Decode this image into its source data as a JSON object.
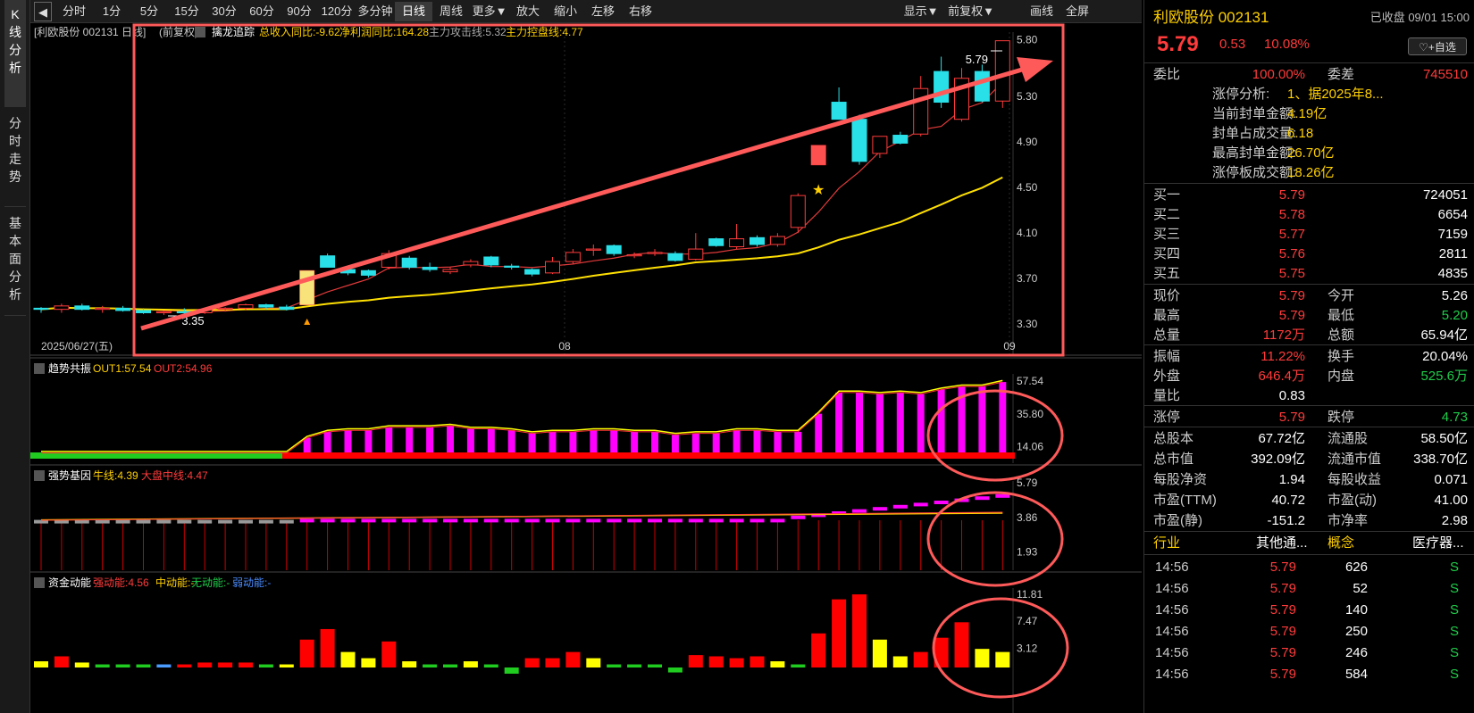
{
  "nav": [
    "K线分析",
    "分时走势",
    "基本面分析"
  ],
  "toolbar": {
    "left": [
      "分时",
      "1分",
      "5分",
      "15分",
      "30分",
      "60分",
      "90分",
      "120分",
      "多分钟",
      "日线",
      "周线",
      "更多▼",
      "放大",
      "缩小",
      "左移",
      "右移"
    ],
    "right": [
      "显示▼",
      "前复权▼",
      "画线",
      "全屏"
    ],
    "active": "日线"
  },
  "main": {
    "stock": "[利欧股份 002131 日线]",
    "adj": "(前复权)",
    "indicator": "擒龙追踪",
    "f1": "总收入同比:-9.62",
    "f2": "净利润同比:164.28",
    "f3": "主力攻击线:5.32",
    "f4": "主力控盘线:4.77",
    "ylabels": [
      "5.80",
      "5.30",
      "4.90",
      "4.50",
      "4.10",
      "3.70",
      "3.30"
    ],
    "date": "2025/06/27(五)",
    "xl1": "08",
    "xl2": "09",
    "high": "5.79",
    "low": "3.35"
  },
  "p2": {
    "name": "趋势共振",
    "a": "OUT1:57.54",
    "b": "OUT2:54.96",
    "ylabels": [
      "57.54",
      "35.80",
      "14.06"
    ]
  },
  "p3": {
    "name": "强势基因",
    "a": "牛线:4.39",
    "b": "大盘中线:4.47",
    "ylabels": [
      "5.79",
      "3.86",
      "1.93"
    ]
  },
  "p4": {
    "name": "资金动能",
    "a": "强动能:4.56",
    "b": "中动能:-",
    "c": "无动能:-",
    "d": "弱动能:-",
    "ylabels": [
      "11.81",
      "7.47",
      "3.12"
    ]
  },
  "chart_data": {
    "type": "candlestick",
    "candles": [
      [
        3.44,
        3.45,
        3.4,
        3.43
      ],
      [
        3.43,
        3.48,
        3.4,
        3.46
      ],
      [
        3.46,
        3.48,
        3.42,
        3.43
      ],
      [
        3.43,
        3.46,
        3.4,
        3.44
      ],
      [
        3.44,
        3.46,
        3.41,
        3.42
      ],
      [
        3.42,
        3.44,
        3.39,
        3.4
      ],
      [
        3.4,
        3.42,
        3.38,
        3.41
      ],
      [
        3.41,
        3.44,
        3.35,
        3.4
      ],
      [
        3.4,
        3.44,
        3.39,
        3.43
      ],
      [
        3.43,
        3.45,
        3.41,
        3.44
      ],
      [
        3.44,
        3.48,
        3.42,
        3.47
      ],
      [
        3.47,
        3.48,
        3.43,
        3.45
      ],
      [
        3.45,
        3.47,
        3.42,
        3.43
      ],
      [
        3.47,
        3.77,
        3.47,
        3.77
      ],
      [
        3.9,
        3.92,
        3.8,
        3.8
      ],
      [
        3.78,
        3.8,
        3.73,
        3.75
      ],
      [
        3.77,
        3.78,
        3.71,
        3.73
      ],
      [
        3.8,
        3.95,
        3.78,
        3.92
      ],
      [
        3.88,
        3.9,
        3.78,
        3.8
      ],
      [
        3.8,
        3.84,
        3.76,
        3.78
      ],
      [
        3.76,
        3.8,
        3.74,
        3.78
      ],
      [
        3.82,
        3.87,
        3.8,
        3.85
      ],
      [
        3.89,
        3.9,
        3.8,
        3.82
      ],
      [
        3.81,
        3.83,
        3.78,
        3.8
      ],
      [
        3.78,
        3.79,
        3.72,
        3.74
      ],
      [
        3.75,
        3.89,
        3.74,
        3.85
      ],
      [
        3.85,
        3.96,
        3.83,
        3.93
      ],
      [
        3.95,
        4.0,
        3.9,
        3.96
      ],
      [
        3.99,
        4.0,
        3.9,
        3.92
      ],
      [
        3.9,
        3.93,
        3.88,
        3.91
      ],
      [
        3.92,
        3.96,
        3.9,
        3.93
      ],
      [
        3.92,
        3.94,
        3.85,
        3.86
      ],
      [
        3.87,
        4.1,
        3.86,
        3.96
      ],
      [
        4.05,
        4.06,
        3.98,
        3.99
      ],
      [
        3.98,
        4.18,
        3.96,
        4.05
      ],
      [
        4.06,
        4.08,
        3.98,
        4.0
      ],
      [
        4.0,
        4.1,
        3.98,
        4.07
      ],
      [
        4.15,
        4.45,
        4.1,
        4.43
      ],
      [
        4.7,
        4.87,
        4.7,
        4.87
      ],
      [
        5.25,
        5.38,
        5.1,
        5.1
      ],
      [
        5.1,
        5.14,
        4.7,
        4.73
      ],
      [
        4.8,
        4.95,
        4.76,
        4.95
      ],
      [
        4.96,
        4.99,
        4.88,
        4.89
      ],
      [
        4.97,
        5.48,
        4.95,
        5.37
      ],
      [
        5.52,
        5.65,
        5.2,
        5.25
      ],
      [
        5.1,
        5.55,
        5.08,
        5.46
      ],
      [
        5.52,
        5.58,
        5.25,
        5.26
      ],
      [
        5.26,
        5.79,
        5.2,
        5.79
      ]
    ],
    "ylim": [
      3.2,
      5.85
    ],
    "trend": [
      57.54,
      35.8,
      14.06
    ],
    "osc": [
      5.79,
      3.86,
      1.93
    ],
    "flow": [
      11.81,
      7.47,
      3.12
    ]
  },
  "info": {
    "title": "利欧股份 002131",
    "status": "已收盘 09/01 15:00",
    "price": "5.79",
    "chg": "0.53",
    "pct": "10.08%",
    "fav": "♡+自选",
    "webi_l": "委比",
    "webi": "100.00%",
    "wecha_l": "委差",
    "wecha": "745510",
    "zt": [
      [
        "涨停分析:",
        "1、据2025年8..."
      ],
      [
        "当前封单金额:",
        "4.19亿"
      ],
      [
        "封单占成交量:",
        "6.18"
      ],
      [
        "最高封单金额:",
        "26.70亿"
      ],
      [
        "涨停板成交额:",
        "18.26亿"
      ]
    ],
    "buys": [
      [
        "买一",
        "5.79",
        "724051"
      ],
      [
        "买二",
        "5.78",
        "6654"
      ],
      [
        "买三",
        "5.77",
        "7159"
      ],
      [
        "买四",
        "5.76",
        "2811"
      ],
      [
        "买五",
        "5.75",
        "4835"
      ]
    ],
    "q1": [
      [
        "现价",
        "5.79",
        "今开",
        "5.26"
      ],
      [
        "最高",
        "5.79",
        "最低",
        "5.20"
      ],
      [
        "总量",
        "1172万",
        "总额",
        "65.94亿"
      ]
    ],
    "q2": [
      [
        "振幅",
        "11.22%",
        "换手",
        "20.04%"
      ],
      [
        "外盘",
        "646.4万",
        "内盘",
        "525.6万"
      ],
      [
        "量比",
        "0.83",
        "",
        ""
      ]
    ],
    "q3": [
      [
        "涨停",
        "5.79",
        "跌停",
        "4.73"
      ]
    ],
    "q4": [
      [
        "总股本",
        "67.72亿",
        "流通股",
        "58.50亿"
      ],
      [
        "总市值",
        "392.09亿",
        "流通市值",
        "338.70亿"
      ],
      [
        "每股净资",
        "1.94",
        "每股收益",
        "0.071"
      ],
      [
        "市盈(TTM)",
        "40.72",
        "市盈(动)",
        "41.00"
      ],
      [
        "市盈(静)",
        "-151.2",
        "市净率",
        "2.98"
      ]
    ],
    "ind": [
      "行业",
      "其他通...",
      "概念",
      "医疗器..."
    ],
    "ticks": [
      [
        "14:56",
        "5.79",
        "626",
        "S"
      ],
      [
        "14:56",
        "5.79",
        "52",
        "S"
      ],
      [
        "14:56",
        "5.79",
        "140",
        "S"
      ],
      [
        "14:56",
        "5.79",
        "250",
        "S"
      ],
      [
        "14:56",
        "5.79",
        "246",
        "S"
      ],
      [
        "14:56",
        "5.79",
        "584",
        "S"
      ]
    ]
  }
}
